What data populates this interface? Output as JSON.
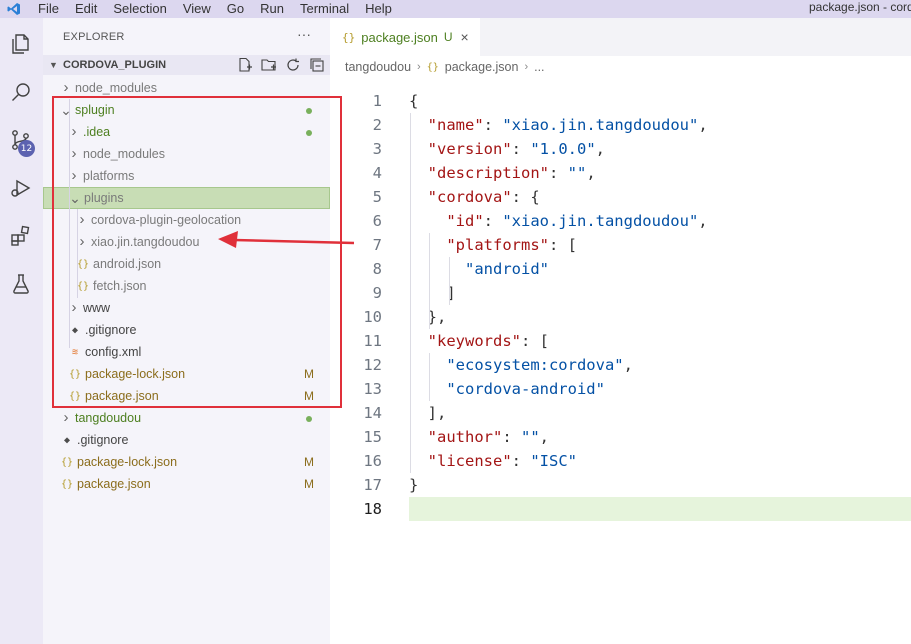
{
  "window": {
    "title": "package.json - cordova_plugin",
    "menu": [
      "File",
      "Edit",
      "Selection",
      "View",
      "Go",
      "Run",
      "Terminal",
      "Help"
    ]
  },
  "activity": {
    "scm_badge": "12"
  },
  "explorer": {
    "header": "EXPLORER",
    "more": "···",
    "section_title": "CORDOVA_PLUGIN",
    "items": [
      {
        "label": "node_modules",
        "depth": 1,
        "kind": "folder",
        "expanded": false,
        "color": "gray",
        "deco": ""
      },
      {
        "label": "splugin",
        "depth": 1,
        "kind": "folder",
        "expanded": true,
        "color": "green",
        "deco": "dot"
      },
      {
        "label": ".idea",
        "depth": 2,
        "kind": "folder",
        "expanded": false,
        "color": "green",
        "deco": "dot"
      },
      {
        "label": "node_modules",
        "depth": 2,
        "kind": "folder",
        "expanded": false,
        "color": "gray",
        "deco": ""
      },
      {
        "label": "platforms",
        "depth": 2,
        "kind": "folder",
        "expanded": false,
        "color": "gray",
        "deco": ""
      },
      {
        "label": "plugins",
        "depth": 2,
        "kind": "folder",
        "expanded": true,
        "color": "gray",
        "deco": "",
        "selected": true
      },
      {
        "label": "cordova-plugin-geolocation",
        "depth": 3,
        "kind": "folder",
        "expanded": false,
        "color": "gray",
        "deco": ""
      },
      {
        "label": "xiao.jin.tangdoudou",
        "depth": 3,
        "kind": "folder",
        "expanded": false,
        "color": "gray",
        "deco": ""
      },
      {
        "label": "android.json",
        "depth": 3,
        "kind": "json",
        "color": "gray",
        "deco": ""
      },
      {
        "label": "fetch.json",
        "depth": 3,
        "kind": "json",
        "color": "gray",
        "deco": ""
      },
      {
        "label": "www",
        "depth": 2,
        "kind": "folder",
        "expanded": false,
        "color": "default",
        "deco": ""
      },
      {
        "label": ".gitignore",
        "depth": 2,
        "kind": "git",
        "color": "default",
        "deco": ""
      },
      {
        "label": "config.xml",
        "depth": 2,
        "kind": "xml",
        "color": "default",
        "deco": ""
      },
      {
        "label": "package-lock.json",
        "depth": 2,
        "kind": "json",
        "color": "mod",
        "deco": "M"
      },
      {
        "label": "package.json",
        "depth": 2,
        "kind": "json",
        "color": "mod",
        "deco": "M"
      },
      {
        "label": "tangdoudou",
        "depth": 1,
        "kind": "folder",
        "expanded": false,
        "color": "green",
        "deco": "dot"
      },
      {
        "label": ".gitignore",
        "depth": 1,
        "kind": "git",
        "color": "default",
        "deco": ""
      },
      {
        "label": "package-lock.json",
        "depth": 1,
        "kind": "json",
        "color": "mod",
        "deco": "M"
      },
      {
        "label": "package.json",
        "depth": 1,
        "kind": "json",
        "color": "mod",
        "deco": "M"
      }
    ]
  },
  "editor": {
    "tab": {
      "label": "package.json",
      "flag": "U",
      "close": "×"
    },
    "breadcrumb": [
      "tangdoudou",
      "package.json",
      "..."
    ],
    "active_line": 18,
    "lines": [
      [
        [
          "p",
          "{"
        ]
      ],
      [
        [
          "p",
          "  "
        ],
        [
          "k",
          "\"name\""
        ],
        [
          "p",
          ": "
        ],
        [
          "s",
          "\"xiao.jin.tangdoudou\""
        ],
        [
          "p",
          ","
        ]
      ],
      [
        [
          "p",
          "  "
        ],
        [
          "k",
          "\"version\""
        ],
        [
          "p",
          ": "
        ],
        [
          "s",
          "\"1.0.0\""
        ],
        [
          "p",
          ","
        ]
      ],
      [
        [
          "p",
          "  "
        ],
        [
          "k",
          "\"description\""
        ],
        [
          "p",
          ": "
        ],
        [
          "s",
          "\"\""
        ],
        [
          "p",
          ","
        ]
      ],
      [
        [
          "p",
          "  "
        ],
        [
          "k",
          "\"cordova\""
        ],
        [
          "p",
          ": {"
        ]
      ],
      [
        [
          "p",
          "    "
        ],
        [
          "k",
          "\"id\""
        ],
        [
          "p",
          ": "
        ],
        [
          "s",
          "\"xiao.jin.tangdoudou\""
        ],
        [
          "p",
          ","
        ]
      ],
      [
        [
          "p",
          "    "
        ],
        [
          "k",
          "\"platforms\""
        ],
        [
          "p",
          ": ["
        ]
      ],
      [
        [
          "p",
          "      "
        ],
        [
          "s",
          "\"android\""
        ]
      ],
      [
        [
          "p",
          "    ]"
        ]
      ],
      [
        [
          "p",
          "  },"
        ]
      ],
      [
        [
          "p",
          "  "
        ],
        [
          "k",
          "\"keywords\""
        ],
        [
          "p",
          ": ["
        ]
      ],
      [
        [
          "p",
          "    "
        ],
        [
          "s",
          "\"ecosystem:cordova\""
        ],
        [
          "p",
          ","
        ]
      ],
      [
        [
          "p",
          "    "
        ],
        [
          "s",
          "\"cordova-android\""
        ]
      ],
      [
        [
          "p",
          "  ],"
        ]
      ],
      [
        [
          "p",
          "  "
        ],
        [
          "k",
          "\"author\""
        ],
        [
          "p",
          ": "
        ],
        [
          "s",
          "\"\""
        ],
        [
          "p",
          ","
        ]
      ],
      [
        [
          "p",
          "  "
        ],
        [
          "k",
          "\"license\""
        ],
        [
          "p",
          ": "
        ],
        [
          "s",
          "\"ISC\""
        ]
      ],
      [
        [
          "p",
          "}"
        ]
      ],
      []
    ]
  }
}
